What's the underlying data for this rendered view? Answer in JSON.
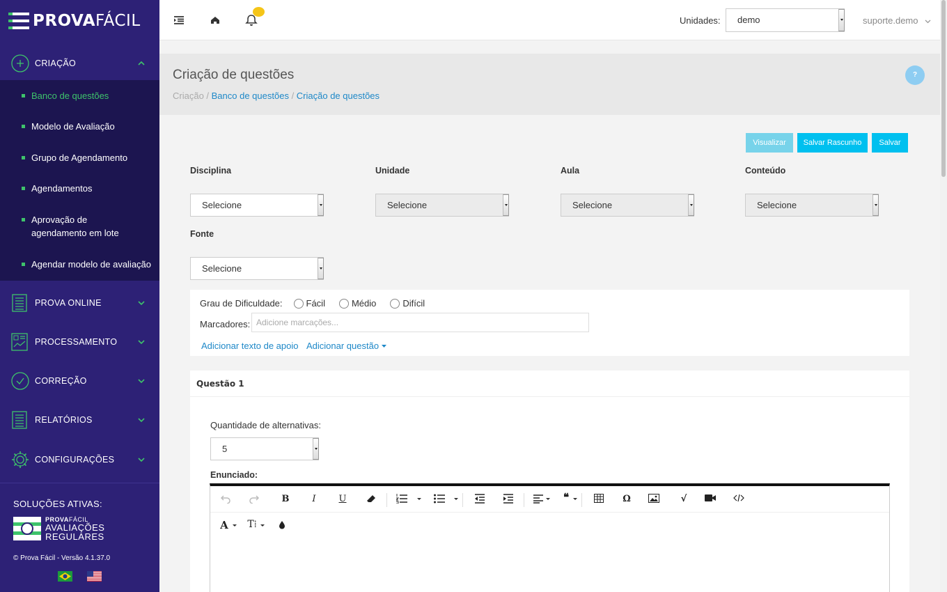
{
  "brand": {
    "strong": "PROVA",
    "light": "FÁCIL"
  },
  "sidebar": {
    "groups": [
      {
        "label": "CRIAÇÃO",
        "icon": "plus-circle-icon"
      },
      {
        "label": "PROVA ONLINE",
        "icon": "document-list-icon"
      },
      {
        "label": "PROCESSAMENTO",
        "icon": "chart-board-icon"
      },
      {
        "label": "CORREÇÃO",
        "icon": "check-circle-icon"
      },
      {
        "label": "RELATÓRIOS",
        "icon": "report-icon"
      },
      {
        "label": "CONFIGURAÇÕES",
        "icon": "gear-icon"
      }
    ],
    "submenu": [
      {
        "label": "Banco de questões",
        "active": true
      },
      {
        "label": "Modelo de Avaliação"
      },
      {
        "label": "Grupo de Agendamento"
      },
      {
        "label": "Agendamentos"
      },
      {
        "label": "Aprovação de agendamento em lote"
      },
      {
        "label": "Agendar modelo de avaliação"
      }
    ],
    "solutions_label": "SOLUÇÕES ATIVAS:",
    "solution": {
      "brand_strong": "PROVA",
      "brand_light": "FÁCIL",
      "line1": "AVALIAÇÕES",
      "line2": "REGULARES"
    },
    "version": "© Prova Fácil - Versão 4.1.37.0"
  },
  "topbar": {
    "units_label": "Unidades:",
    "units_value": "demo",
    "user": "suporte.demo"
  },
  "page": {
    "title": "Criação de questões",
    "breadcrumb": [
      "Criação",
      "Banco de questões",
      "Criação de questões"
    ],
    "help": "?"
  },
  "actions": {
    "preview": "Visualizar",
    "save_draft": "Salvar Rascunho",
    "save": "Salvar"
  },
  "filters": [
    {
      "label": "Disciplina",
      "value": "Selecione",
      "disabled": false
    },
    {
      "label": "Unidade",
      "value": "Selecione",
      "disabled": true
    },
    {
      "label": "Aula",
      "value": "Selecione",
      "disabled": true
    },
    {
      "label": "Conteúdo",
      "value": "Selecione",
      "disabled": true
    },
    {
      "label": "Fonte",
      "value": "Selecione",
      "disabled": false
    }
  ],
  "difficulty": {
    "label": "Grau de Dificuldade:",
    "options": [
      "Fácil",
      "Médio",
      "Difícil"
    ]
  },
  "tags": {
    "label": "Marcadores:",
    "placeholder": "Adicione marcações..."
  },
  "links": {
    "support_text": "Adicionar texto de apoio",
    "add_question": "Adicionar questão"
  },
  "question": {
    "title": "Questão 1",
    "alternatives_label": "Quantidade de alternativas:",
    "alternatives_value": "5",
    "statement_label": "Enunciado:"
  },
  "colors": {
    "sidebar": "#2d2176",
    "submenu": "#1c1550",
    "accent": "#3ec36b",
    "primary": "#00c0ef",
    "link": "#1e88c8"
  }
}
